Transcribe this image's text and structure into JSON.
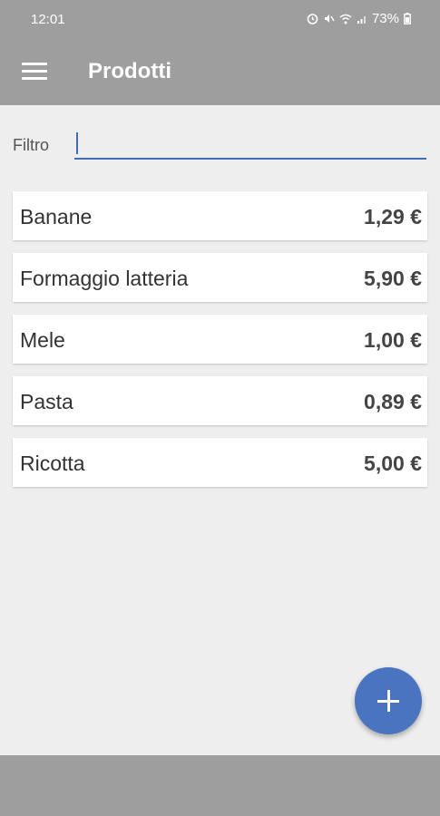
{
  "status_bar": {
    "time": "12:01",
    "battery": "73%",
    "icons": [
      "alarm-icon",
      "mute-icon",
      "wifi-icon",
      "signal-icon",
      "battery-icon"
    ]
  },
  "app_bar": {
    "title": "Prodotti",
    "menu_icon": "hamburger-menu-icon"
  },
  "filter": {
    "label": "Filtro",
    "value": ""
  },
  "products": [
    {
      "name": "Banane",
      "price": "1,29 €"
    },
    {
      "name": "Formaggio latteria",
      "price": "5,90 €"
    },
    {
      "name": "Mele",
      "price": "1,00 €"
    },
    {
      "name": "Pasta",
      "price": "0,89 €"
    },
    {
      "name": "Ricotta",
      "price": "5,00 €"
    }
  ],
  "fab": {
    "icon": "plus-icon"
  },
  "colors": {
    "bar": "#9e9e9e",
    "accent": "#4a74c0",
    "background": "#eeeeee"
  }
}
